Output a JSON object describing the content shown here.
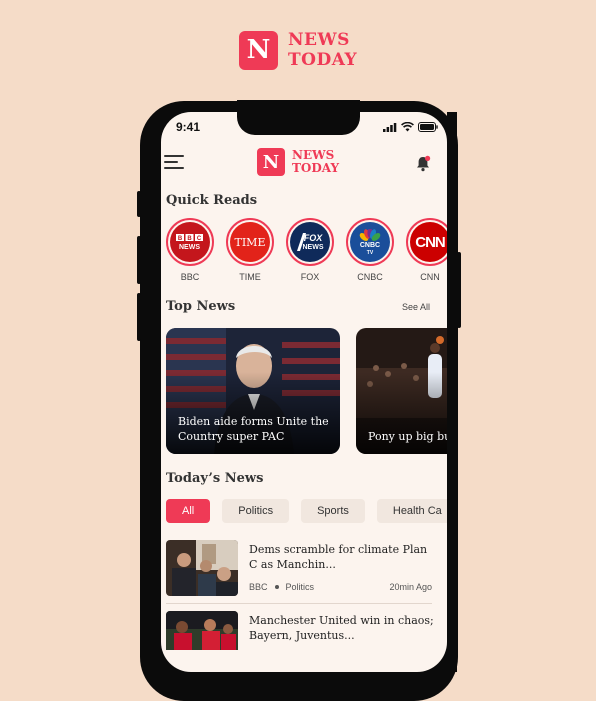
{
  "brand": {
    "logo_letter": "N",
    "line1": "NEWS",
    "line2": "TODAY",
    "color": "#ef3a56"
  },
  "status": {
    "time": "9:41"
  },
  "header": {
    "logo_letter": "N",
    "line1": "NEWS",
    "line2": "TODAY"
  },
  "quick_reads": {
    "title": "Quick Reads",
    "sources": [
      {
        "label": "BBC",
        "logo": "BBC\nNEWS",
        "color": "#c4161c"
      },
      {
        "label": "TIME",
        "logo": "TIME",
        "color": "#e2231a"
      },
      {
        "label": "FOX",
        "logo": "FOX\nNEWS",
        "color": "#0f2a5a"
      },
      {
        "label": "CNBC",
        "logo": "CNBC\nTV",
        "color": "#1a4e9a"
      },
      {
        "label": "CNN",
        "logo": "CNN",
        "color": "#cc0000"
      }
    ]
  },
  "top_news": {
    "title": "Top News",
    "see_all": "See All",
    "cards": [
      {
        "headline": "Biden aide forms Unite the Country super PAC"
      },
      {
        "headline": "Pony up big bu the band. The"
      }
    ]
  },
  "todays_news": {
    "title": "Today’s News",
    "categories": [
      "All",
      "Politics",
      "Sports",
      "Health Ca"
    ],
    "active_category": "All",
    "items": [
      {
        "title": "Dems scramble for climate Plan C as Manchin...",
        "source": "BBC",
        "category": "Politics",
        "time": "20min Ago"
      },
      {
        "title": "Manchester United win in chaos; Bayern, Juventus...",
        "source": "",
        "category": "",
        "time": ""
      }
    ]
  }
}
